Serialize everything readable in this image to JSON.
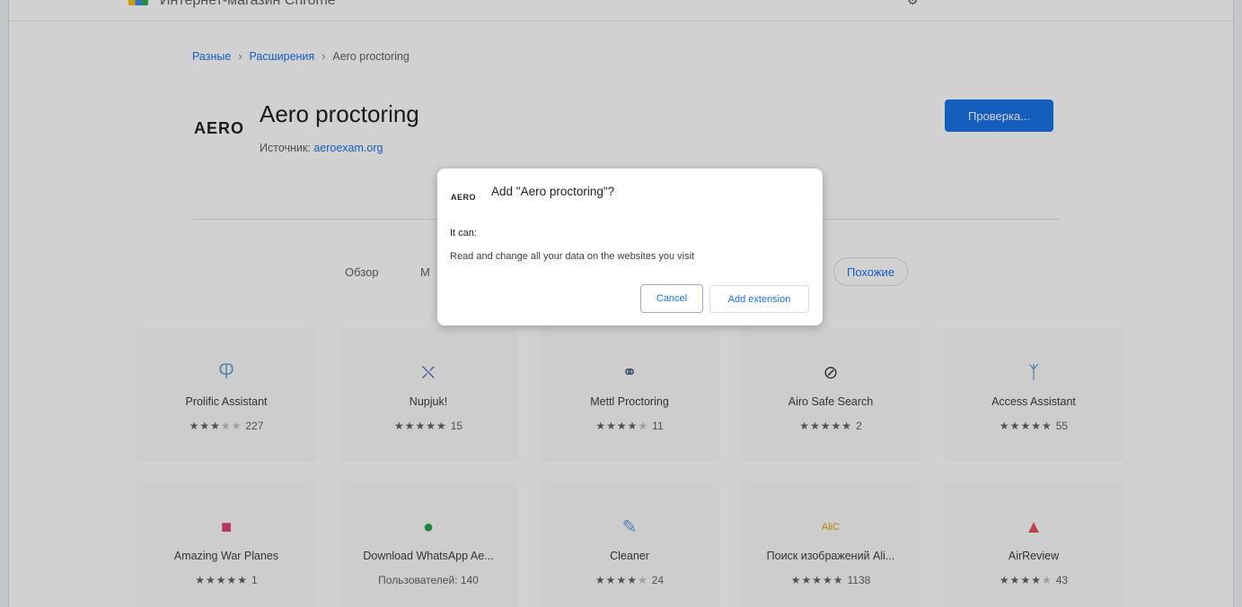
{
  "store": {
    "title": "Интернет-магазин Chrome"
  },
  "breadcrumb": {
    "items": [
      "Разные",
      "Расширения",
      "Aero proctoring"
    ],
    "separator": "›"
  },
  "extension": {
    "logo_text": "AERO",
    "title": "Aero proctoring",
    "source_label": "Источник:",
    "source_domain": "aeroexam.org",
    "check_button": "Проверка..."
  },
  "tabs": [
    "Обзор",
    "М",
    "Похожие"
  ],
  "cards": [
    {
      "icon": "pinwheel-icon",
      "glyph": "Ⴔ",
      "color": "#6aa7d8",
      "name": "Prolific Assistant",
      "stars_on": 3,
      "stars_off": 2,
      "meta": "227"
    },
    {
      "icon": "drone-icon",
      "glyph": "⛌",
      "color": "#5f6fb5",
      "name": "Nupjuk!",
      "stars_on": 5,
      "stars_off": 0,
      "meta": "15"
    },
    {
      "icon": "binoculars-icon",
      "glyph": "⚭",
      "color": "#3f5c8a",
      "name": "Mettl Proctoring",
      "stars_on": 4,
      "stars_off": 1,
      "meta": "11"
    },
    {
      "icon": "airo-logo-icon",
      "glyph": "⊘",
      "color": "#3c4043",
      "name": "Airo Safe Search",
      "stars_on": 5,
      "stars_off": 0,
      "meta": "2"
    },
    {
      "icon": "access-logo-icon",
      "glyph": "ᛉ",
      "color": "#2f6fb0",
      "name": "Access Assistant",
      "stars_on": 5,
      "stars_off": 0,
      "meta": "55"
    },
    {
      "icon": "war-planes-icon",
      "glyph": "■",
      "color": "#d9437a",
      "name": "Amazing War Planes",
      "stars_on": 5,
      "stars_off": 0,
      "meta": "1"
    },
    {
      "icon": "whatsapp-icon",
      "glyph": "●",
      "color": "#25a244",
      "name": "Download WhatsApp Ae...",
      "stars_on": 0,
      "stars_off": 0,
      "meta": "Пользователей: 140"
    },
    {
      "icon": "broom-icon",
      "glyph": "✎",
      "color": "#6b9be0",
      "name": "Cleaner",
      "stars_on": 4,
      "stars_off": 1,
      "meta": "24"
    },
    {
      "icon": "alic-logo-icon",
      "glyph": "AliC",
      "color": "#e0a100",
      "name": "Поиск изображений Ali...",
      "stars_on": 5,
      "stars_off": 0,
      "meta": "1138"
    },
    {
      "icon": "airreview-icon",
      "glyph": "▲",
      "color": "#e2535b",
      "name": "AirReview",
      "stars_on": 4,
      "stars_off": 1,
      "meta": "43"
    }
  ],
  "dialog": {
    "logo_text": "AERO",
    "title": "Add \"Aero proctoring\"?",
    "it_can": "It can:",
    "permission": "Read and change all your data on the websites you visit",
    "cancel_label": "Cancel",
    "add_label": "Add extension"
  }
}
